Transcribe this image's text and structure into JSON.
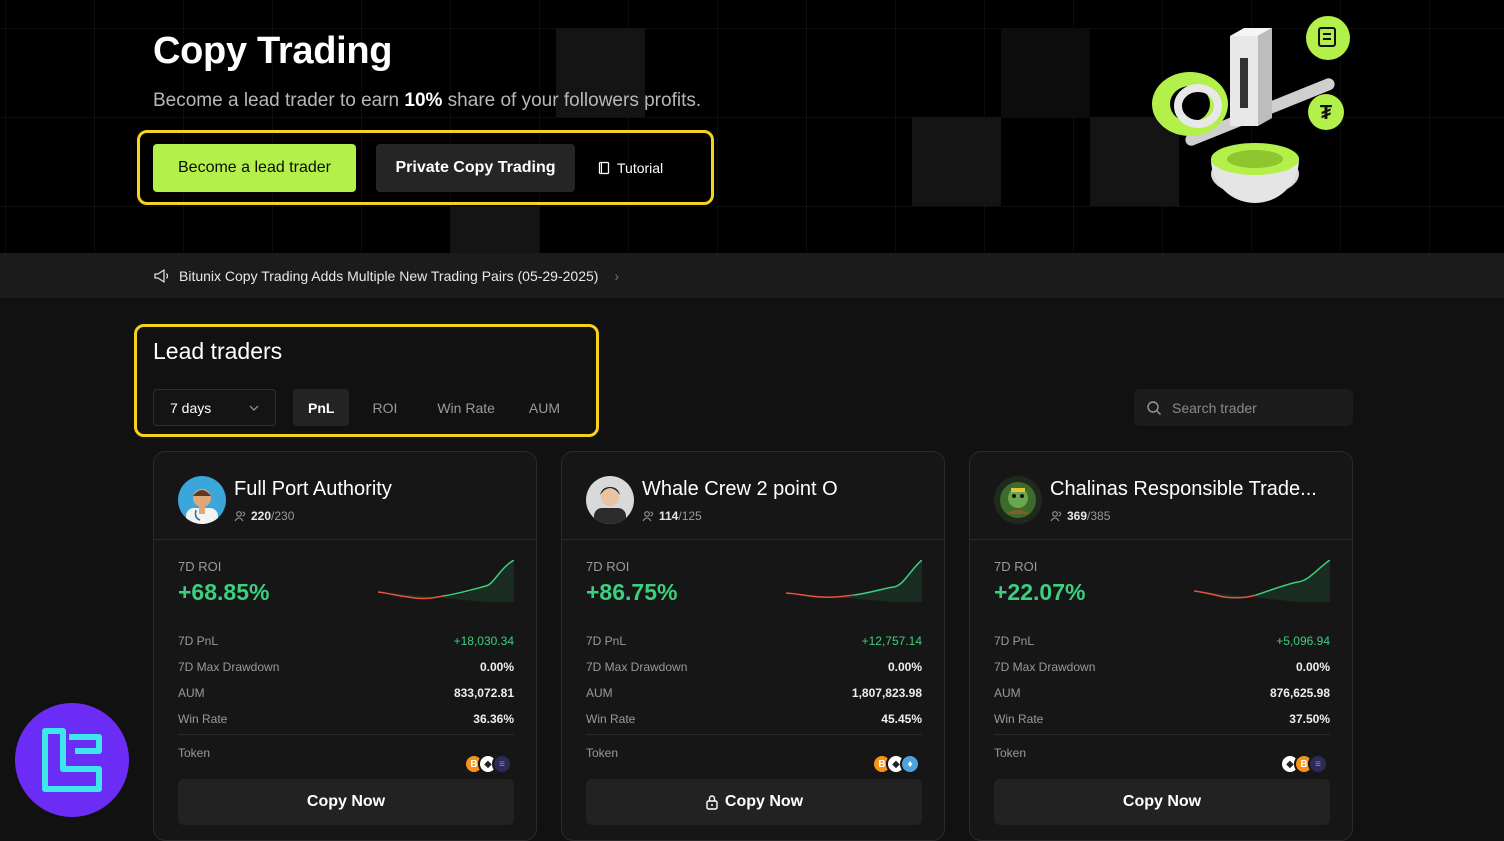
{
  "hero": {
    "title": "Copy Trading",
    "subtitle_pre": "Become a lead trader to earn ",
    "subtitle_bold": "10%",
    "subtitle_post": " share of your followers profits.",
    "primary_button": "Become a lead trader",
    "secondary_button": "Private Copy Trading",
    "tutorial_link": "Tutorial"
  },
  "announcement": {
    "text": "Bitunix Copy Trading Adds Multiple New Trading Pairs (05-29-2025)"
  },
  "lead": {
    "title": "Lead traders",
    "period": "7 days",
    "tabs": [
      "PnL",
      "ROI",
      "Win Rate",
      "AUM"
    ],
    "active_tab": "PnL",
    "search_placeholder": "Search trader"
  },
  "traders": [
    {
      "name": "Full Port Authority",
      "followers": "220",
      "followers_max": "/230",
      "roi_label": "7D ROI",
      "roi": "+68.85%",
      "stats": [
        {
          "k": "7D PnL",
          "v": "+18,030.34"
        },
        {
          "k": "7D Max Drawdown",
          "v": "0.00%"
        },
        {
          "k": "AUM",
          "v": "833,072.81"
        },
        {
          "k": "Win Rate",
          "v": "36.36%"
        }
      ],
      "token_label": "Token",
      "copy_label": "Copy Now"
    },
    {
      "name": "Whale Crew 2 point O",
      "followers": "114",
      "followers_max": "/125",
      "roi_label": "7D ROI",
      "roi": "+86.75%",
      "stats": [
        {
          "k": "7D PnL",
          "v": "+12,757.14"
        },
        {
          "k": "7D Max Drawdown",
          "v": "0.00%"
        },
        {
          "k": "AUM",
          "v": "1,807,823.98"
        },
        {
          "k": "Win Rate",
          "v": "45.45%"
        }
      ],
      "token_label": "Token",
      "copy_label": "Copy Now"
    },
    {
      "name": "Chalinas Responsible Trade...",
      "followers": "369",
      "followers_max": "/385",
      "roi_label": "7D ROI",
      "roi": "+22.07%",
      "stats": [
        {
          "k": "7D PnL",
          "v": "+5,096.94"
        },
        {
          "k": "7D Max Drawdown",
          "v": "0.00%"
        },
        {
          "k": "AUM",
          "v": "876,625.98"
        },
        {
          "k": "Win Rate",
          "v": "37.50%"
        }
      ],
      "token_label": "Token",
      "copy_label": "Copy Now"
    }
  ],
  "colors": {
    "accent": "#b3f04a",
    "positive": "#3ccf7e",
    "negative": "#e5533d",
    "highlight": "#f6d21c"
  }
}
